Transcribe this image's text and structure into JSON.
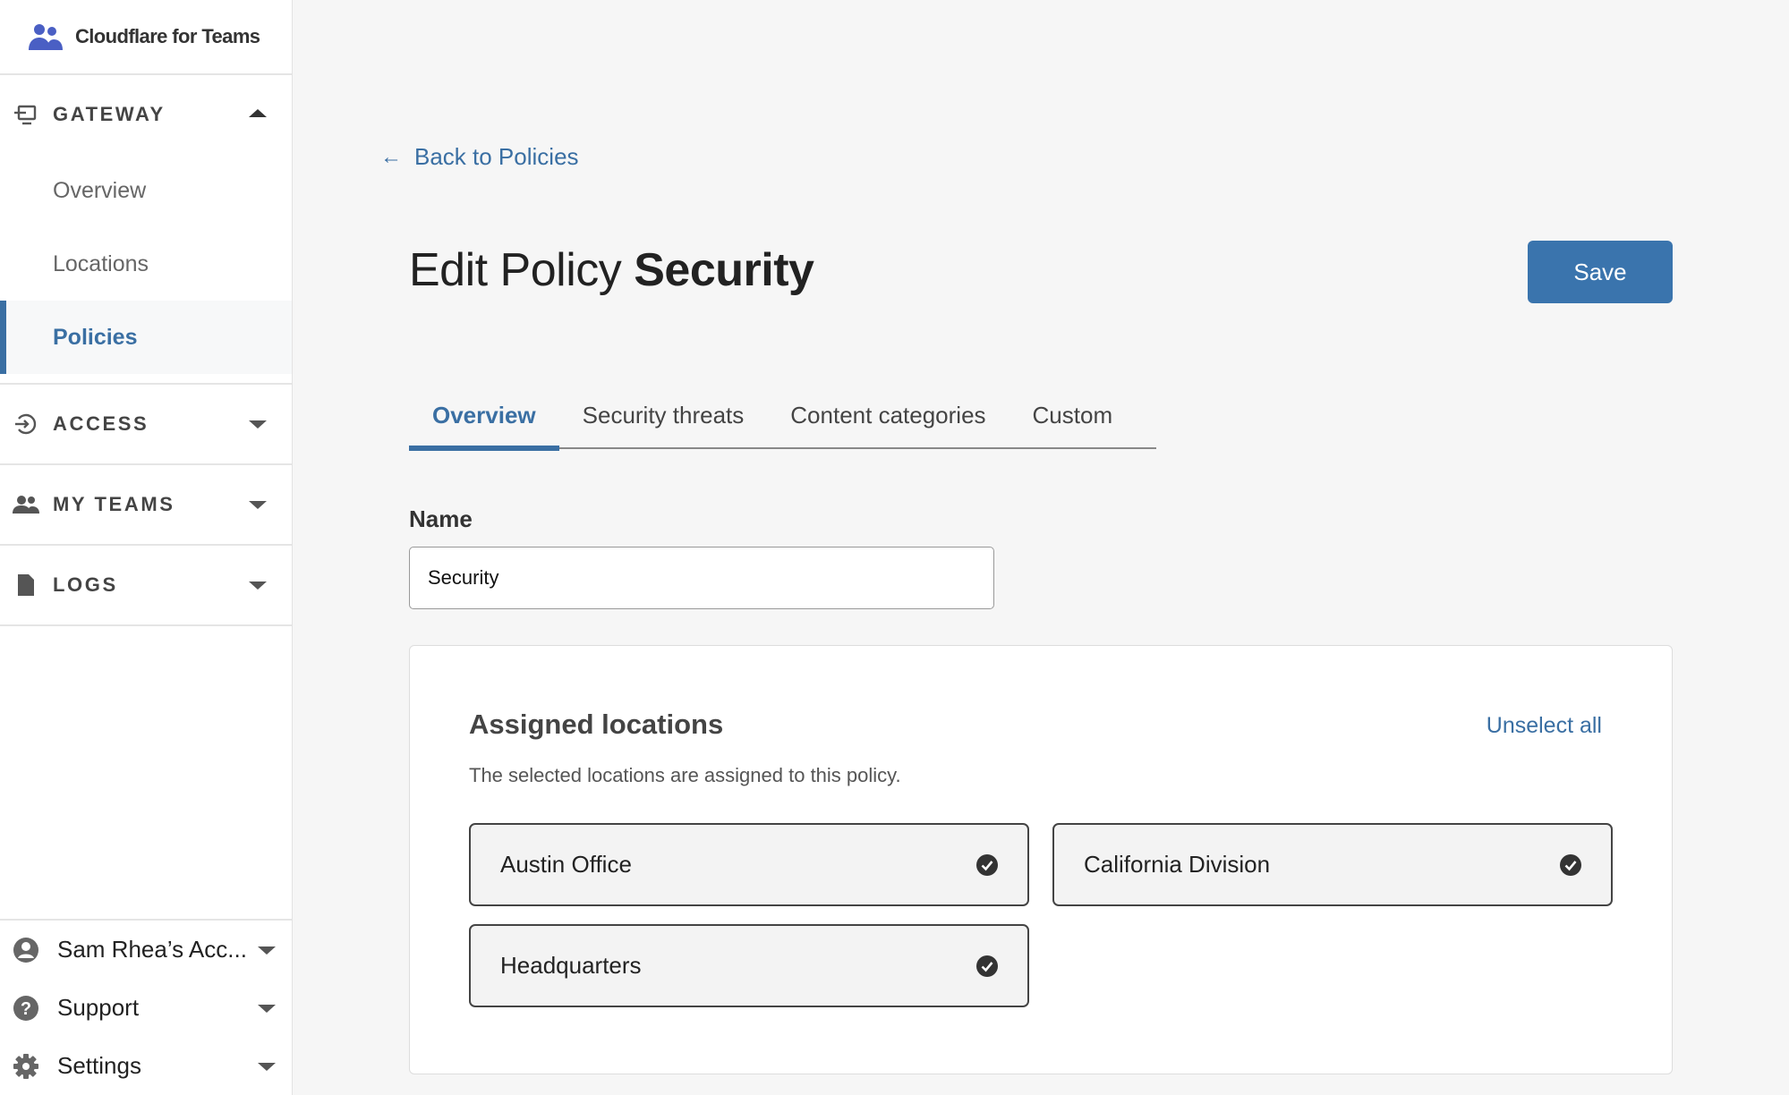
{
  "brand": {
    "name": "Cloudflare for Teams"
  },
  "sidebar": {
    "gateway": {
      "title": "GATEWAY",
      "items": [
        {
          "label": "Overview",
          "active": false
        },
        {
          "label": "Locations",
          "active": false
        },
        {
          "label": "Policies",
          "active": true
        }
      ]
    },
    "sections": [
      {
        "title": "ACCESS",
        "icon": "access-icon"
      },
      {
        "title": "MY TEAMS",
        "icon": "people-icon"
      },
      {
        "title": "LOGS",
        "icon": "document-icon"
      }
    ],
    "bottom": [
      {
        "label": "Sam Rhea’s Acc...",
        "icon": "user-circle-icon"
      },
      {
        "label": "Support",
        "icon": "help-icon"
      },
      {
        "label": "Settings",
        "icon": "gear-icon"
      }
    ]
  },
  "main": {
    "back_link": "Back to Policies",
    "title_prefix": "Edit Policy",
    "title_name": "Security",
    "save_label": "Save",
    "tabs": [
      "Overview",
      "Security threats",
      "Content categories",
      "Custom"
    ],
    "active_tab": "Overview",
    "name_label": "Name",
    "name_value": "Security",
    "card": {
      "title": "Assigned locations",
      "unselect_all": "Unselect all",
      "description": "The selected locations are assigned to this policy.",
      "locations": [
        {
          "label": "Austin Office",
          "selected": true
        },
        {
          "label": "California Division",
          "selected": true
        },
        {
          "label": "Headquarters",
          "selected": true
        }
      ]
    }
  },
  "colors": {
    "accent": "#3a6fa3",
    "button": "#3a74ad",
    "brand_icon": "#4a5fc4"
  }
}
